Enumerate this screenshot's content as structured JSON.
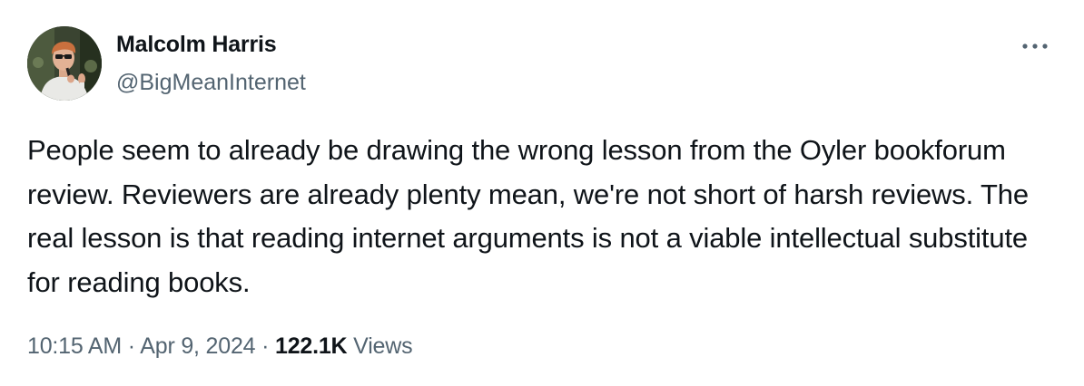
{
  "author": {
    "name": "Malcolm Harris",
    "handle": "@BigMeanInternet"
  },
  "more_icon": "more-horizontal-icon",
  "tweet": {
    "text": "People seem to already be drawing the wrong lesson from the Oyler bookforum review. Reviewers are already plenty mean, we're not short of harsh reviews. The real lesson is that reading internet arguments is not a viable intellectual substitute for reading books."
  },
  "meta": {
    "time": "10:15 AM",
    "separator": "·",
    "date": "Apr 9, 2024",
    "views_count": "122.1K",
    "views_label": "Views"
  },
  "colors": {
    "text_primary": "#0f1419",
    "text_secondary": "#536471"
  }
}
